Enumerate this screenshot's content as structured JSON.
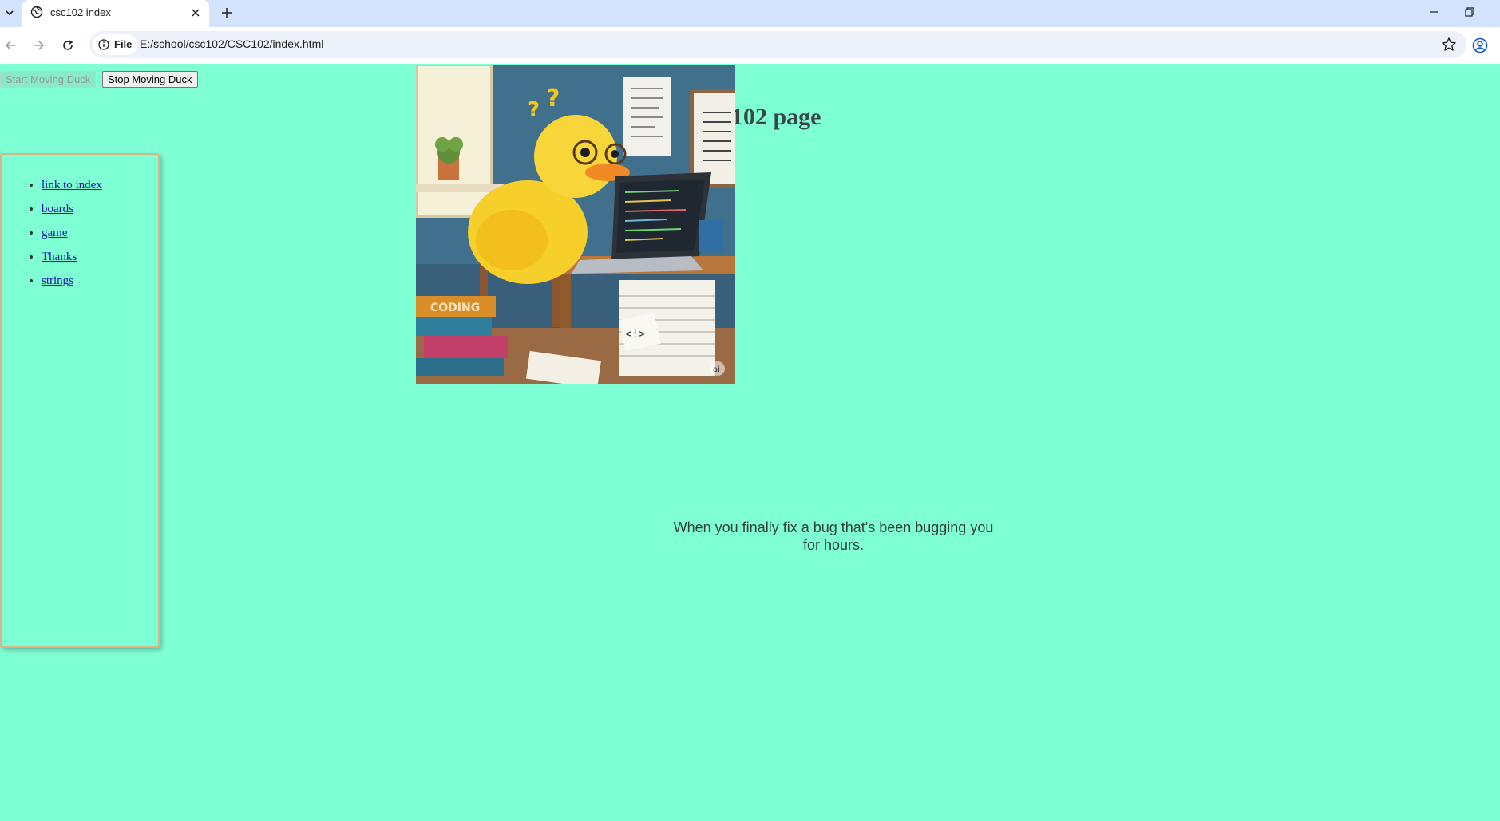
{
  "browser": {
    "tab_title": "csc102 index",
    "address_chip": "File",
    "url": "E:/school/csc102/CSC102/index.html"
  },
  "page": {
    "background": "#7fffd4",
    "buttons": {
      "start_label": "Start Moving Duck",
      "stop_label": "Stop Moving Duck"
    },
    "nav_links": [
      {
        "label": "link to index"
      },
      {
        "label": "boards"
      },
      {
        "label": "game"
      },
      {
        "label": "Thanks"
      },
      {
        "label": "strings"
      }
    ],
    "heading": "102 page",
    "quote_line1": "When you finally fix a bug that's been bugging you",
    "quote_line2": "for hours.",
    "image": {
      "description_icon": "duck-coding-illustration",
      "watermark": "ai",
      "book_label": "CODING",
      "note_label": "<!>"
    }
  }
}
